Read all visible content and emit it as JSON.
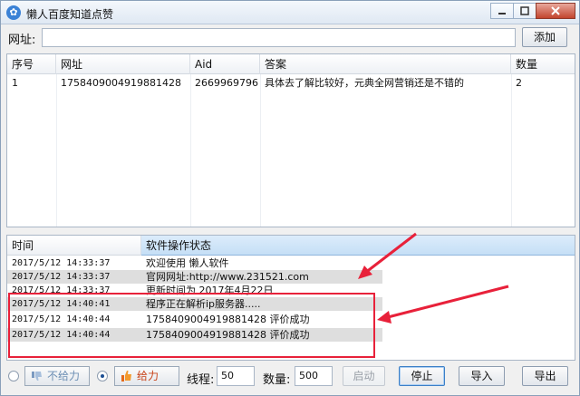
{
  "window": {
    "title": "懒人百度知道点赞",
    "app_icon": "baidu-paw-icon"
  },
  "url_bar": {
    "label": "网址:",
    "value": "",
    "add_label": "添加"
  },
  "tasks": {
    "columns": [
      "序号",
      "网址",
      "Aid",
      "答案",
      "数量"
    ],
    "rows": [
      {
        "index": "1",
        "url": "1758409004919881428",
        "aid": "2669969796",
        "answer": "具体去了解比较好，元典全网营销还是不错的",
        "count": "2"
      }
    ]
  },
  "log": {
    "col_time": "时间",
    "col_status": "软件操作状态",
    "rows": [
      {
        "time": "2017/5/12 14:33:37",
        "msg": "欢迎使用  懒人软件"
      },
      {
        "time": "2017/5/12 14:33:37",
        "msg": "官网网址:http://www.231521.com"
      },
      {
        "time": "2017/5/12 14:33:37",
        "msg": "更新时间为   2017年4月22日"
      },
      {
        "time": "2017/5/12 14:40:41",
        "msg": "程序正在解析ip服务器....."
      },
      {
        "time": "2017/5/12 14:40:44",
        "msg": "1758409004919881428   评价成功"
      },
      {
        "time": "2017/5/12 14:40:44",
        "msg": "1758409004919881428   评价成功"
      }
    ]
  },
  "controls": {
    "mode_options": [
      "不给力",
      "给力"
    ],
    "mode_selected": "给力",
    "threads_label": "线程:",
    "threads_value": "50",
    "quantity_label": "数量:",
    "quantity_value": "500",
    "start_label": "启动",
    "stop_label": "停止",
    "import_label": "导入",
    "export_label": "导出"
  },
  "colors": {
    "annotation_red": "#e8213a",
    "selected_header": "#c5dff6",
    "close_red": "#c2442d"
  }
}
